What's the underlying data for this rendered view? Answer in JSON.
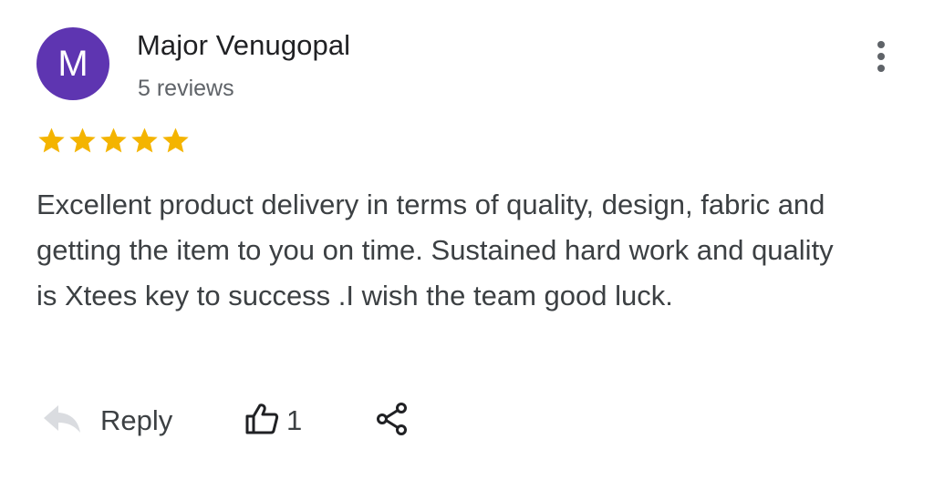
{
  "review": {
    "author": {
      "initial": "M",
      "name": "Major Venugopal",
      "reviews_count": "5 reviews",
      "avatar_color": "#5e35b1"
    },
    "rating": 5,
    "rating_max": 5,
    "star_color": "#f4b400",
    "text": "Excellent product delivery in terms of quality, design, fabric and getting the item to you on time. Sustained hard work and quality is Xtees key to success .I wish the team good luck.",
    "actions": {
      "reply_label": "Reply",
      "like_count": "1",
      "reply_icon": "reply-arrow-icon",
      "like_icon": "thumbs-up-icon",
      "share_icon": "share-icon",
      "menu_icon": "more-vert-icon"
    }
  }
}
